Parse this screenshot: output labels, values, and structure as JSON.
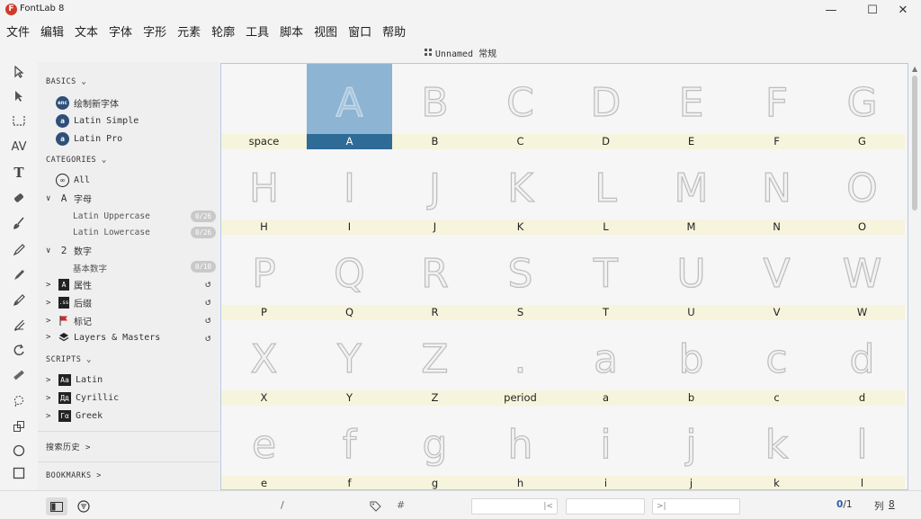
{
  "app": {
    "title": "FontLab 8",
    "logo": "F"
  },
  "window": {
    "minimize": "—",
    "maximize": "☐",
    "close": "✕"
  },
  "menu": [
    "文件",
    "编辑",
    "文本",
    "字体",
    "字形",
    "元素",
    "轮廓",
    "工具",
    "脚本",
    "视图",
    "窗口",
    "帮助"
  ],
  "document": {
    "title": "Unnamed 常规"
  },
  "tools": [
    "pointer-icon",
    "contour-pointer-icon",
    "metrics-icon",
    "kerning-icon",
    "text-icon",
    "eraser-icon",
    "brush-icon",
    "pen-icon",
    "rapid-pen-icon",
    "pencil-icon",
    "knife-icon",
    "rotate-icon",
    "ruler-icon",
    "lasso-icon",
    "scale-icon",
    "ellipse-icon",
    "rectangle-icon"
  ],
  "sidebar": {
    "basics_header": "BASICS",
    "basics": [
      {
        "icon": "enc",
        "label": "绘制新字体"
      },
      {
        "icon": "a",
        "label": "Latin Simple"
      },
      {
        "icon": "a",
        "label": "Latin Pro"
      }
    ],
    "categories_header": "CATEGORIES",
    "all": {
      "icon": "∞",
      "label": "All"
    },
    "letters": {
      "icon": "A",
      "label": "字母",
      "sub": [
        {
          "label": "Latin Uppercase",
          "badge": "0/26"
        },
        {
          "label": "Latin Lowercase",
          "badge": "0/26"
        }
      ]
    },
    "digits": {
      "icon": "2",
      "label": "数字",
      "sub": [
        {
          "label": "基本数字",
          "badge": "0/10"
        }
      ]
    },
    "groups": [
      {
        "label": "属性",
        "icon": "A"
      },
      {
        "label": "后缀",
        "icon": ".ss"
      },
      {
        "label": "标记",
        "icon": "flag"
      },
      {
        "label": "Layers & Masters",
        "icon": "layers"
      }
    ],
    "scripts_header": "SCRIPTS",
    "scripts": [
      {
        "icon": "Aa",
        "label": "Latin"
      },
      {
        "icon": "Дд",
        "label": "Cyrillic"
      },
      {
        "icon": "Γα",
        "label": "Greek"
      }
    ],
    "search_history": "搜索历史",
    "bookmarks": "BOOKMARKS"
  },
  "glyphs": [
    {
      "name": "space",
      "char": ""
    },
    {
      "name": "A",
      "char": "A",
      "selected": true
    },
    {
      "name": "B",
      "char": "B"
    },
    {
      "name": "C",
      "char": "C"
    },
    {
      "name": "D",
      "char": "D"
    },
    {
      "name": "E",
      "char": "E"
    },
    {
      "name": "F",
      "char": "F"
    },
    {
      "name": "G",
      "char": "G"
    },
    {
      "name": "H",
      "char": "H"
    },
    {
      "name": "I",
      "char": "I"
    },
    {
      "name": "J",
      "char": "J"
    },
    {
      "name": "K",
      "char": "K"
    },
    {
      "name": "L",
      "char": "L"
    },
    {
      "name": "M",
      "char": "M"
    },
    {
      "name": "N",
      "char": "N"
    },
    {
      "name": "O",
      "char": "O"
    },
    {
      "name": "P",
      "char": "P"
    },
    {
      "name": "Q",
      "char": "Q"
    },
    {
      "name": "R",
      "char": "R"
    },
    {
      "name": "S",
      "char": "S"
    },
    {
      "name": "T",
      "char": "T"
    },
    {
      "name": "U",
      "char": "U"
    },
    {
      "name": "V",
      "char": "V"
    },
    {
      "name": "W",
      "char": "W"
    },
    {
      "name": "X",
      "char": "X"
    },
    {
      "name": "Y",
      "char": "Y"
    },
    {
      "name": "Z",
      "char": "Z"
    },
    {
      "name": "period",
      "char": "."
    },
    {
      "name": "a",
      "char": "a"
    },
    {
      "name": "b",
      "char": "b"
    },
    {
      "name": "c",
      "char": "c"
    },
    {
      "name": "d",
      "char": "d"
    },
    {
      "name": "e",
      "char": "e"
    },
    {
      "name": "f",
      "char": "f"
    },
    {
      "name": "g",
      "char": "g"
    },
    {
      "name": "h",
      "char": "h"
    },
    {
      "name": "i",
      "char": "i"
    },
    {
      "name": "j",
      "char": "j"
    },
    {
      "name": "k",
      "char": "k"
    },
    {
      "name": "l",
      "char": "l"
    }
  ],
  "status": {
    "slash": "/",
    "hash": "#",
    "field_left_glyph": "|<",
    "field_right_glyph": ">|",
    "count_current": "0",
    "count_total": "/1",
    "columns_label": "列",
    "columns_value": "8"
  }
}
